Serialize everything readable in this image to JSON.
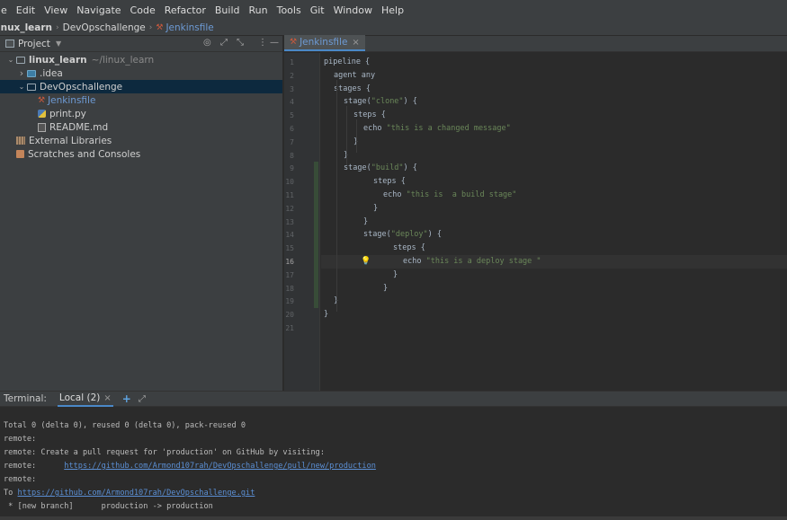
{
  "menu": [
    "e",
    "Edit",
    "View",
    "Navigate",
    "Code",
    "Refactor",
    "Build",
    "Run",
    "Tools",
    "Git",
    "Window",
    "Help"
  ],
  "breadcrumb": [
    "inux_learn",
    "DevOpschallenge",
    "Jenkinsfile"
  ],
  "project_panel": {
    "title": "Project",
    "tree": [
      {
        "label": "linux_learn",
        "hint": "~/linux_learn",
        "level": 0,
        "type": "folder",
        "expanded": true
      },
      {
        "label": ".idea",
        "level": 1,
        "type": "idea",
        "expanded": false
      },
      {
        "label": "DevOpschallenge",
        "level": 1,
        "type": "folder",
        "expanded": true,
        "selected": true
      },
      {
        "label": "Jenkinsfile",
        "level": 2,
        "type": "jenkins"
      },
      {
        "label": "print.py",
        "level": 2,
        "type": "python"
      },
      {
        "label": "README.md",
        "level": 2,
        "type": "markdown"
      },
      {
        "label": "External Libraries",
        "level": 0,
        "type": "library"
      },
      {
        "label": "Scratches and Consoles",
        "level": 0,
        "type": "scratch"
      }
    ]
  },
  "editor": {
    "tab_label": "Jenkinsfile",
    "current_line": 16,
    "lines": [
      {
        "n": "1",
        "indent": 0,
        "code": "pipeline {",
        "str": ""
      },
      {
        "n": "2",
        "indent": 1,
        "code": "agent any",
        "str": ""
      },
      {
        "n": "3",
        "indent": 1,
        "code": "stages {",
        "str": ""
      },
      {
        "n": "4",
        "indent": 2,
        "code": "stage(",
        "str": "\"clone\"",
        "post": ") {"
      },
      {
        "n": "5",
        "indent": 3,
        "code": "steps {",
        "str": ""
      },
      {
        "n": "6",
        "indent": 4,
        "code": "echo ",
        "str": "\"this is a changed message\""
      },
      {
        "n": "7",
        "indent": 3,
        "code": "}",
        "str": ""
      },
      {
        "n": "8",
        "indent": 2,
        "code": "}",
        "str": ""
      },
      {
        "n": "9",
        "indent": 2,
        "code": "stage(",
        "str": "\"build\"",
        "post": ") {"
      },
      {
        "n": "10",
        "indent": 5,
        "code": "steps {",
        "str": ""
      },
      {
        "n": "11",
        "indent": 6,
        "code": "echo ",
        "str": "\"this is  a build stage\""
      },
      {
        "n": "12",
        "indent": 5,
        "code": "}",
        "str": ""
      },
      {
        "n": "13",
        "indent": 4,
        "code": "}",
        "str": ""
      },
      {
        "n": "14",
        "indent": 4,
        "code": "stage(",
        "str": "\"deploy\"",
        "post": ") {"
      },
      {
        "n": "15",
        "indent": 7,
        "code": "steps {",
        "str": ""
      },
      {
        "n": "16",
        "indent": 8,
        "code": "echo ",
        "str": "\"this is a deploy stage \""
      },
      {
        "n": "17",
        "indent": 7,
        "code": "}",
        "str": ""
      },
      {
        "n": "18",
        "indent": 6,
        "code": "}",
        "str": ""
      },
      {
        "n": "19",
        "indent": 1,
        "code": "}",
        "str": ""
      },
      {
        "n": "20",
        "indent": 0,
        "code": "}",
        "str": ""
      },
      {
        "n": "21",
        "indent": 0,
        "code": "",
        "str": ""
      }
    ]
  },
  "terminal": {
    "label": "Terminal:",
    "tab_label": "Local (2)",
    "lines": [
      {
        "text": "Total 0 (delta 0), reused 0 (delta 0), pack-reused 0"
      },
      {
        "text": "remote:"
      },
      {
        "text": "remote: Create a pull request for 'production' on GitHub by visiting:"
      },
      {
        "text": "remote:      ",
        "link": "https://github.com/Armond107rah/DevOpschallenge/pull/new/production"
      },
      {
        "text": "remote:"
      },
      {
        "text": "To ",
        "link": "https://github.com/Armond107rah/DevOpschallenge.git"
      },
      {
        "text": " * [new branch]      production -> production"
      }
    ]
  }
}
